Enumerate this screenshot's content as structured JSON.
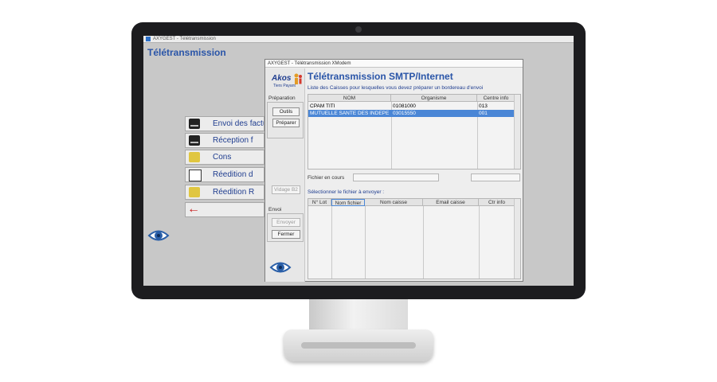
{
  "background_app": {
    "window_title": "AXYGEST - Télétransmission",
    "page_title": "Télétransmission",
    "menu": [
      {
        "label": "Envoi des factu",
        "icon": "drive-icon"
      },
      {
        "label": "Réception f",
        "icon": "drive-icon"
      },
      {
        "label": "Cons",
        "icon": "coins-icon"
      },
      {
        "label": "Réedition d",
        "icon": "document-icon"
      },
      {
        "label": "Réedition R",
        "icon": "coins-icon"
      },
      {
        "label": "",
        "icon": "back-arrow-icon"
      }
    ]
  },
  "dialog": {
    "window_title": "AXYGEST - Télétransmission XModem",
    "logo_text": "Akos",
    "logo_subtext": "Tiers Payant",
    "heading": "Télétransmission SMTP/Internet",
    "instruction": "Liste des Caisses pour lesquelles vous devez préparer un bordereau d'envoi",
    "preparation": {
      "group_label": "Préparation",
      "outils_label": "Outils",
      "preparer_label": "Préparer"
    },
    "vidage_label": "Vidage B2",
    "envoi": {
      "group_label": "Envoi",
      "envoyer_label": "Envoyer",
      "fermer_label": "Fermer"
    },
    "caisses_table": {
      "columns": [
        "NOM",
        "Organisme",
        "Centre info"
      ],
      "rows": [
        [
          "CPAM TITI",
          "01081000",
          "013"
        ],
        [
          "MUTUELLE SANTE DES INDEPE",
          "03015550",
          "001"
        ]
      ],
      "selected_row": 1
    },
    "fichier_en_cours_label": "Fichier en cours",
    "select_file_label": "Sélectionner le fichier à envoyer :",
    "files_table": {
      "columns": [
        "N° Lot",
        "Nom fichier",
        "Nom caisse",
        "Email caisse",
        "Ctr info"
      ]
    }
  },
  "colors": {
    "title_blue": "#2a55a8",
    "selection": "#4a86d6",
    "bezel": "#1c1c1f"
  }
}
